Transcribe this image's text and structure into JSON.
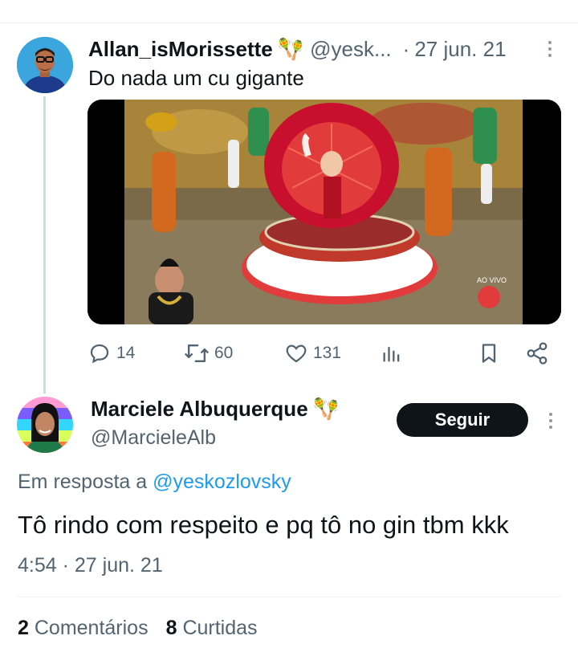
{
  "parent_tweet": {
    "author_name": "Allan_isMorissette",
    "author_emoji": "🪇",
    "handle": "@yesk...",
    "separator": "·",
    "date": "27 jun. 21",
    "text": "Do nada um cu gigante",
    "media": {
      "overlay_label": "AO VIVO"
    },
    "actions": {
      "replies": "14",
      "retweets": "60",
      "likes": "131"
    }
  },
  "reply_tweet": {
    "author_name": "Marciele Albuquerque",
    "author_emoji": "🪇",
    "handle": "@MarcieleAlb",
    "follow_label": "Seguir",
    "reply_to_prefix": "Em resposta a",
    "reply_to_handle": "@yeskozlovsky",
    "text": "Tô rindo com respeito e pq tô no gin tbm kkk",
    "time": "4:54",
    "separator": "·",
    "date": "27 jun. 21",
    "stats": {
      "comments_count": "2",
      "comments_label": "Comentários",
      "shares_count": "8",
      "shares_label": "Curtidas"
    }
  },
  "colors": {
    "text_primary": "#0f1419",
    "text_secondary": "#536471",
    "link": "#1d9bf0",
    "button_bg": "#0f1419"
  },
  "icons": [
    "more-vertical-icon",
    "reply-icon",
    "retweet-icon",
    "like-icon",
    "views-icon",
    "bookmark-icon",
    "share-icon"
  ]
}
